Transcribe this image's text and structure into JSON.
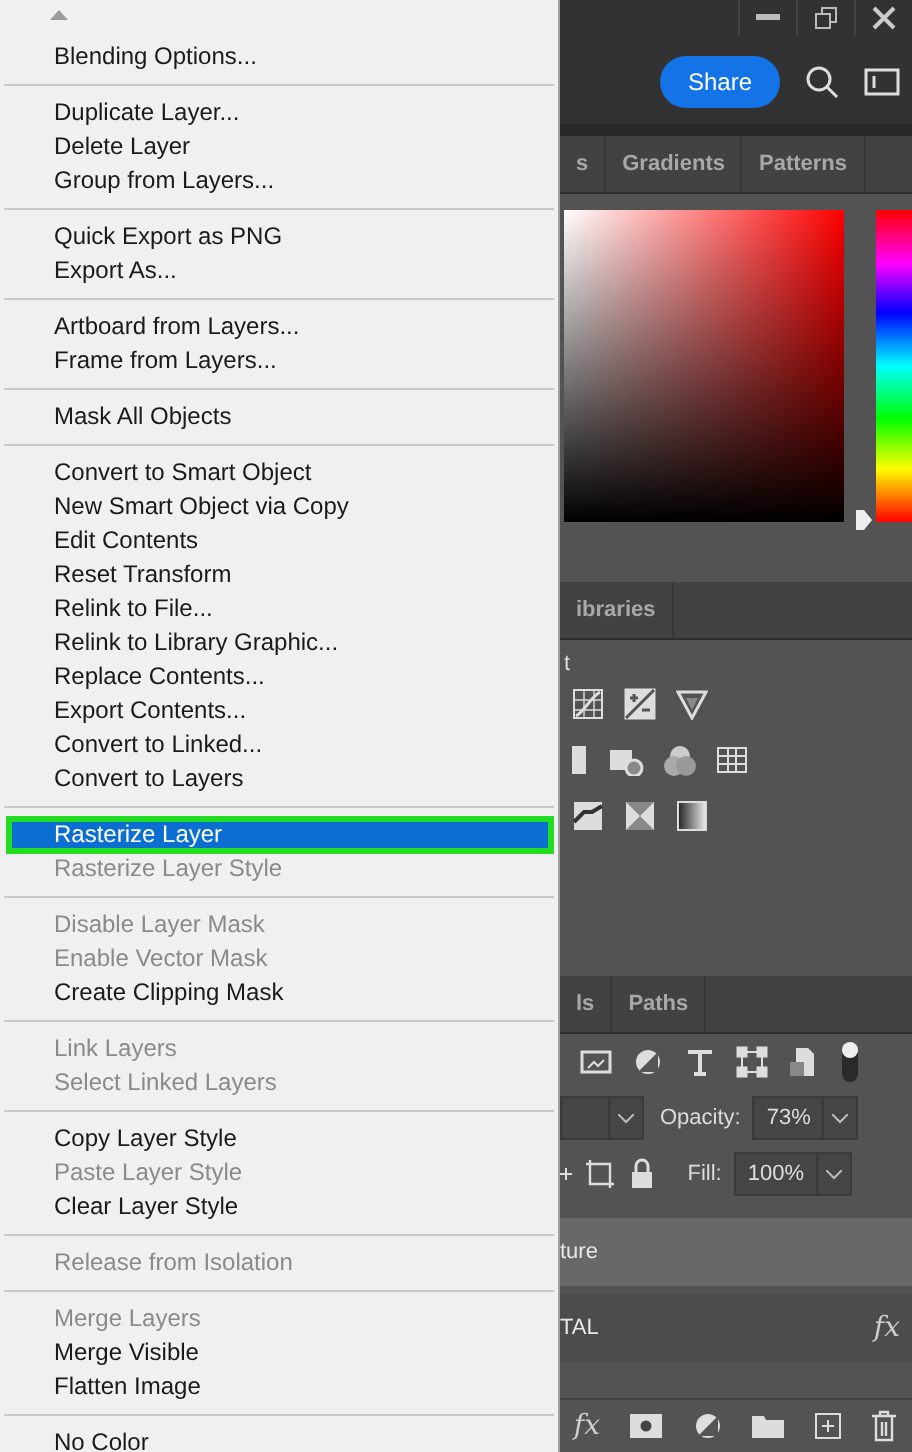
{
  "context_menu": {
    "groups": [
      {
        "items": [
          {
            "label": "Blending Options...",
            "disabled": false,
            "selected": false
          }
        ]
      },
      {
        "items": [
          {
            "label": "Duplicate Layer...",
            "disabled": false,
            "selected": false
          },
          {
            "label": "Delete Layer",
            "disabled": false,
            "selected": false
          },
          {
            "label": "Group from Layers...",
            "disabled": false,
            "selected": false
          }
        ]
      },
      {
        "items": [
          {
            "label": "Quick Export as PNG",
            "disabled": false,
            "selected": false
          },
          {
            "label": "Export As...",
            "disabled": false,
            "selected": false
          }
        ]
      },
      {
        "items": [
          {
            "label": "Artboard from Layers...",
            "disabled": false,
            "selected": false
          },
          {
            "label": "Frame from Layers...",
            "disabled": false,
            "selected": false
          }
        ]
      },
      {
        "items": [
          {
            "label": "Mask All Objects",
            "disabled": false,
            "selected": false
          }
        ]
      },
      {
        "items": [
          {
            "label": "Convert to Smart Object",
            "disabled": false,
            "selected": false
          },
          {
            "label": "New Smart Object via Copy",
            "disabled": false,
            "selected": false
          },
          {
            "label": "Edit Contents",
            "disabled": false,
            "selected": false
          },
          {
            "label": "Reset Transform",
            "disabled": false,
            "selected": false
          },
          {
            "label": "Relink to File...",
            "disabled": false,
            "selected": false
          },
          {
            "label": "Relink to Library Graphic...",
            "disabled": false,
            "selected": false
          },
          {
            "label": "Replace Contents...",
            "disabled": false,
            "selected": false
          },
          {
            "label": "Export Contents...",
            "disabled": false,
            "selected": false
          },
          {
            "label": "Convert to Linked...",
            "disabled": false,
            "selected": false
          },
          {
            "label": "Convert to Layers",
            "disabled": false,
            "selected": false
          }
        ]
      },
      {
        "items": [
          {
            "label": "Rasterize Layer",
            "disabled": false,
            "selected": true
          },
          {
            "label": "Rasterize Layer Style",
            "disabled": true,
            "selected": false
          }
        ]
      },
      {
        "items": [
          {
            "label": "Disable Layer Mask",
            "disabled": true,
            "selected": false
          },
          {
            "label": "Enable Vector Mask",
            "disabled": true,
            "selected": false
          },
          {
            "label": "Create Clipping Mask",
            "disabled": false,
            "selected": false
          }
        ]
      },
      {
        "items": [
          {
            "label": "Link Layers",
            "disabled": true,
            "selected": false
          },
          {
            "label": "Select Linked Layers",
            "disabled": true,
            "selected": false
          }
        ]
      },
      {
        "items": [
          {
            "label": "Copy Layer Style",
            "disabled": false,
            "selected": false
          },
          {
            "label": "Paste Layer Style",
            "disabled": true,
            "selected": false
          },
          {
            "label": "Clear Layer Style",
            "disabled": false,
            "selected": false
          }
        ]
      },
      {
        "items": [
          {
            "label": "Release from Isolation",
            "disabled": true,
            "selected": false
          }
        ]
      },
      {
        "items": [
          {
            "label": "Merge Layers",
            "disabled": true,
            "selected": false
          },
          {
            "label": "Merge Visible",
            "disabled": false,
            "selected": false
          },
          {
            "label": "Flatten Image",
            "disabled": false,
            "selected": false
          }
        ]
      },
      {
        "items": [
          {
            "label": "No Color",
            "disabled": false,
            "selected": false
          }
        ]
      }
    ]
  },
  "toolbar": {
    "share_button": "Share"
  },
  "color_panel": {
    "hue": {
      "level": 0
    },
    "tabs": [
      {
        "label": "s",
        "selected": false
      },
      {
        "label": "Gradients",
        "selected": false
      },
      {
        "label": "Patterns",
        "selected": false
      }
    ]
  },
  "adjustments_panel": {
    "tabs": [
      {
        "label": "ibraries",
        "selected": false
      }
    ],
    "title": "t"
  },
  "layers_panel": {
    "tabs": [
      {
        "label": "ls",
        "selected": false
      },
      {
        "label": "Paths",
        "selected": false
      }
    ],
    "opacity_label": "Opacity:",
    "opacity": "73%",
    "fill_label": "Fill:",
    "fill": "100%",
    "layers": [
      {
        "name": "ture",
        "selected": true
      },
      {
        "name": "TAL",
        "selected": false,
        "effects": "fx"
      }
    ],
    "footer_effects": "fx"
  }
}
